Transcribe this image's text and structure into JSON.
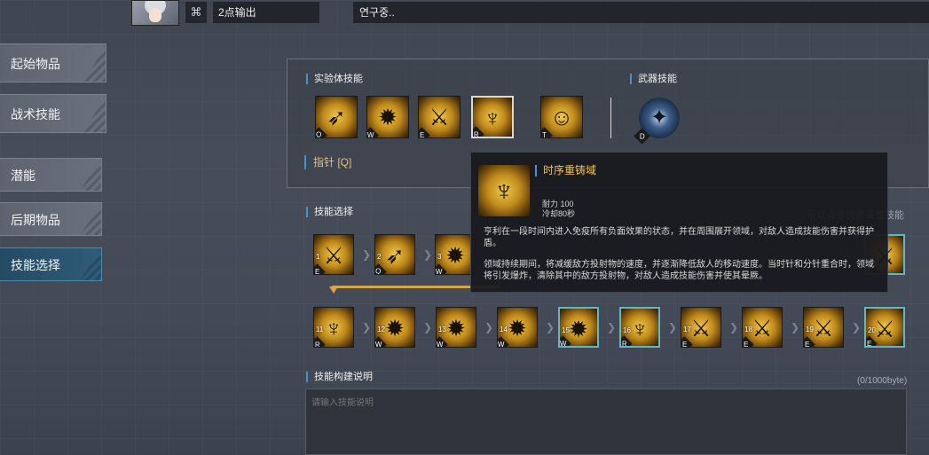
{
  "topbar": {
    "pin_icon": "⌘",
    "build_name": "2点输出",
    "build_status": "연구중.."
  },
  "sidebar": {
    "items": [
      {
        "label": "起始物品",
        "active": false
      },
      {
        "label": "战术技能",
        "active": false
      },
      {
        "label": "潜能",
        "active": false
      },
      {
        "label": "后期物品",
        "active": false
      },
      {
        "label": "技能选择",
        "active": true
      }
    ]
  },
  "skills_panel": {
    "experiment_title": "实验体技能",
    "weapon_title": "武器技能",
    "experiment_skills": [
      {
        "key": "Q",
        "icon": "spear-strike-icon"
      },
      {
        "key": "W",
        "icon": "golden-clock-icon"
      },
      {
        "key": "E",
        "icon": "dash-slash-icon"
      },
      {
        "key": "R",
        "icon": "time-domain-icon"
      },
      {
        "key": "T",
        "icon": "portrait-passive-icon"
      }
    ],
    "weapon_skill": {
      "key": "D",
      "icon": "shuriken-icon"
    },
    "hint": "指针 [Q]"
  },
  "skill_selection": {
    "title": "技能选择",
    "hint": "可以点击快速设置技能",
    "row1": [
      {
        "level": "1",
        "key": "E"
      },
      {
        "level": "2",
        "key": "Q"
      },
      {
        "level": "3",
        "key": "W"
      },
      {
        "level": "10",
        "key": "E"
      }
    ],
    "row2": [
      {
        "level": "11",
        "key": "R"
      },
      {
        "level": "12",
        "key": "W"
      },
      {
        "level": "13",
        "key": "W"
      },
      {
        "level": "14",
        "key": "W"
      },
      {
        "level": "15",
        "key": "W"
      },
      {
        "level": "16",
        "key": "R"
      },
      {
        "level": "17",
        "key": "E"
      },
      {
        "level": "18",
        "key": "E"
      },
      {
        "level": "19",
        "key": "E"
      },
      {
        "level": "20",
        "key": "E"
      }
    ]
  },
  "description": {
    "title": "技能构建说明",
    "counter": "(0/1000byte)",
    "placeholder": "请输入技能说明"
  },
  "tooltip": {
    "name": "时序重铸域",
    "durability": "耐力 100",
    "cooldown": "冷却80秒",
    "desc1": "亨利在一段时间内进入免疫所有负面效果的状态，并在周围展开领域，对敌人造成技能伤害并获得护盾。",
    "desc2": "领域持续期间，将减缓敌方投射物的速度，并逐渐降低敌人的移动速度。当时针和分针重合时，领域将引发爆炸，清除其中的敌方投射物，对敌人造成技能伤害并使其晕厥。"
  },
  "colors": {
    "accent_blue": "#4a8fd0",
    "gold": "#f0c35a",
    "active_tab": "#2f5c78",
    "teal_frame": "#5fb8c5"
  }
}
